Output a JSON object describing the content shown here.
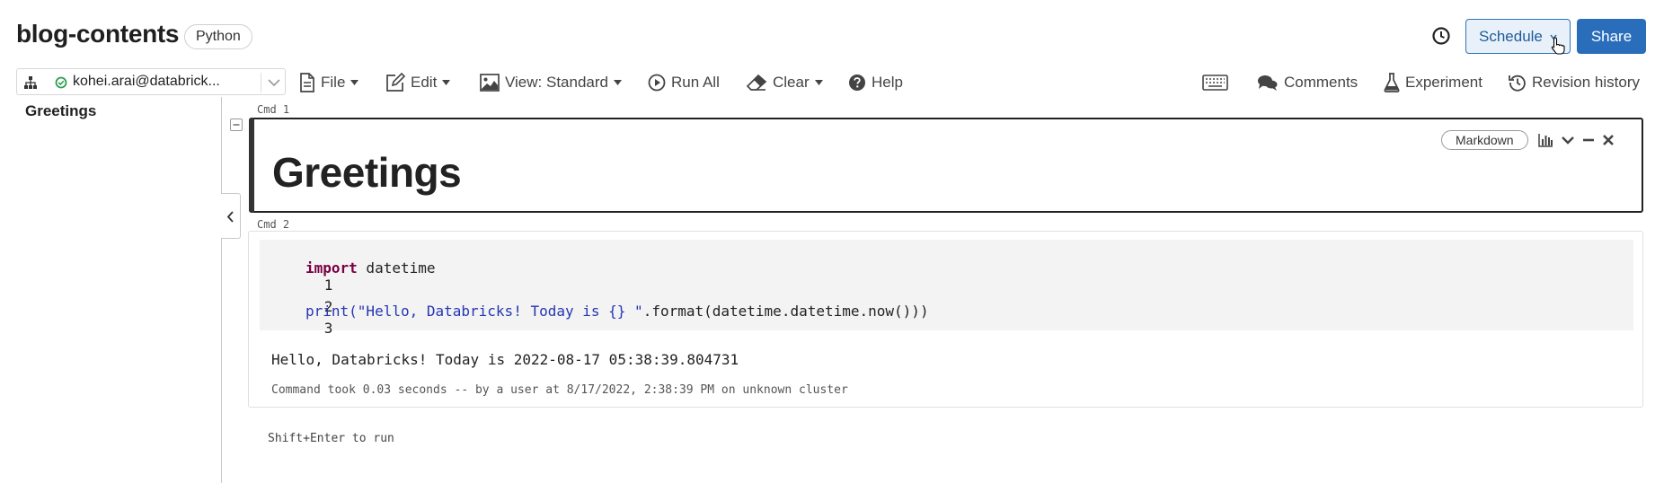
{
  "header": {
    "title": "blog-contents",
    "language": "Python",
    "schedule_label": "Schedule",
    "share_label": "Share",
    "icons": [
      "history-icon",
      "chevron-down-icon",
      "cursor-icon"
    ]
  },
  "toolbar": {
    "cluster_name": "kohei.arai@databrick...",
    "cluster_status": "running",
    "file_label": "File",
    "edit_label": "Edit",
    "view_label": "View: Standard",
    "run_all_label": "Run All",
    "clear_label": "Clear",
    "help_label": "Help",
    "comments_label": "Comments",
    "experiment_label": "Experiment",
    "revision_label": "Revision history",
    "accent_color": "#2a6ebb"
  },
  "sidebar": {
    "items": [
      {
        "label": "Greetings"
      }
    ]
  },
  "cells": [
    {
      "cmd_label": "Cmd 1",
      "type_badge": "Markdown",
      "heading": "Greetings"
    },
    {
      "cmd_label": "Cmd 2",
      "code": [
        {
          "num": "1",
          "keyword": "import",
          "rest": " datetime"
        },
        {
          "num": "2",
          "keyword": "",
          "rest": ""
        },
        {
          "num": "3",
          "fn": "print(",
          "string": "\"Hello, Databricks! Today is {} \"",
          "rest": ".format(datetime.datetime.now()))"
        }
      ],
      "output": "Hello, Databricks! Today is 2022-08-17 05:38:39.804731",
      "status": "Command took 0.03 seconds -- by a user at 8/17/2022, 2:38:39 PM on unknown cluster"
    }
  ],
  "hint": "Shift+Enter to run"
}
